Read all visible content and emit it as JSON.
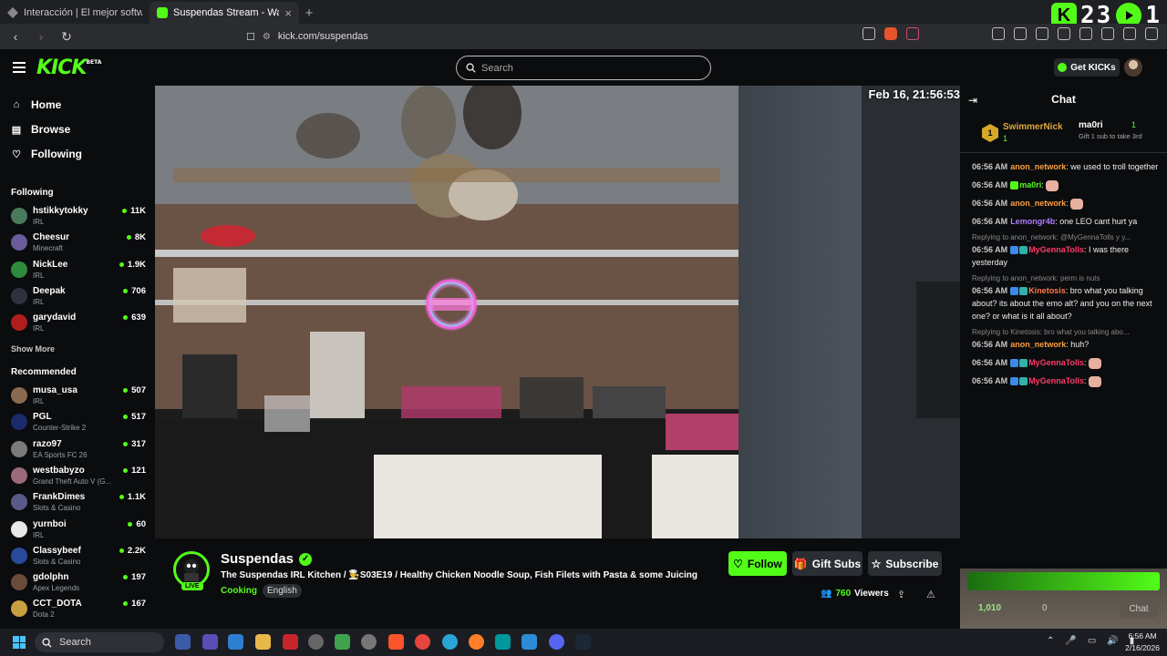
{
  "browser": {
    "tabs": [
      {
        "title": "Interacción | El mejor software para p",
        "active": false
      },
      {
        "title": "Suspendas Stream - Watch Li",
        "active": true
      }
    ],
    "new_tab": "+",
    "url": "kick.com/suspendas"
  },
  "overlay_counter": {
    "value": "23",
    "suffix": "1"
  },
  "header": {
    "logo": "KICK",
    "logo_badge": "BETA",
    "search_placeholder": "Search",
    "get_kicks_label": "Get KICKs"
  },
  "sidebar": {
    "nav": [
      {
        "label": "Home",
        "icon": "home-icon"
      },
      {
        "label": "Browse",
        "icon": "browse-icon"
      },
      {
        "label": "Following",
        "icon": "heart-icon"
      }
    ],
    "following_heading": "Following",
    "following": [
      {
        "name": "hstikkytokky",
        "category": "IRL",
        "viewers": "11K",
        "color": "#4a7a5c"
      },
      {
        "name": "Cheesur",
        "category": "Minecraft",
        "viewers": "8K",
        "color": "#6a5b9a"
      },
      {
        "name": "NickLee",
        "category": "IRL",
        "viewers": "1.9K",
        "color": "#2e8b3e"
      },
      {
        "name": "Deepak",
        "category": "IRL",
        "viewers": "706",
        "color": "#2d3140"
      },
      {
        "name": "garydavid",
        "category": "IRL",
        "viewers": "639",
        "color": "#b01d1d"
      }
    ],
    "show_more": "Show More",
    "recommended_heading": "Recommended",
    "recommended": [
      {
        "name": "musa_usa",
        "category": "IRL",
        "viewers": "507",
        "color": "#8a6a50"
      },
      {
        "name": "PGL",
        "category": "Counter-Strike 2",
        "viewers": "517",
        "color": "#1a2a6a"
      },
      {
        "name": "razo97",
        "category": "EA Sports FC 26",
        "viewers": "317",
        "color": "#7a7a7a"
      },
      {
        "name": "westbabyzo",
        "category": "Grand Theft Auto V (G...",
        "viewers": "121",
        "color": "#9a6a7a"
      },
      {
        "name": "FrankDimes",
        "category": "Slots & Casino",
        "viewers": "1.1K",
        "color": "#5a5a8a"
      },
      {
        "name": "yurnboi",
        "category": "IRL",
        "viewers": "60",
        "color": "#e8e8e8"
      },
      {
        "name": "Classybeef",
        "category": "Slots & Casino",
        "viewers": "2.2K",
        "color": "#2a4a9a"
      },
      {
        "name": "gdolphn",
        "category": "Apex Legends",
        "viewers": "197",
        "color": "#6a4a3a"
      },
      {
        "name": "CCT_DOTA",
        "category": "Dota 2",
        "viewers": "167",
        "color": "#c8a040"
      }
    ]
  },
  "video": {
    "timestamp": "Feb 16, 21:56:53"
  },
  "stream": {
    "streamer": "Suspendas",
    "live_label": "LIVE",
    "title": "The Suspendas IRL Kitchen / 👨‍🍳S03E19 / Healthy Chicken Noodle Soup, Fish Filets with Pasta & some Juicing",
    "category": "Cooking",
    "language": "English",
    "follow_label": "Follow",
    "gift_label": "Gift Subs",
    "subscribe_label": "Subscribe",
    "viewers": "760",
    "viewers_label": "Viewers"
  },
  "chat": {
    "heading": "Chat",
    "pinned_user": "SwimmerNick",
    "pinned_rank": "1",
    "pinned_count": "1",
    "gifter": "ma0ri",
    "gifter_count": "1",
    "gift_text": "Gift 1 sub to take 3rd",
    "messages": [
      {
        "time": "06:56 AM",
        "user": "anon_network",
        "color": "#ff9f40",
        "text": "we used to troll together",
        "reply": ""
      },
      {
        "time": "06:56 AM",
        "user": "ma0ri",
        "color": "#53fc18",
        "text": "",
        "reply": ""
      },
      {
        "time": "06:56 AM",
        "user": "anon_network",
        "color": "#ff9f40",
        "text": "",
        "reply": ""
      },
      {
        "time": "06:56 AM",
        "user": "Lemongr4b",
        "color": "#b07cff",
        "text": "one LEO cant hurt ya",
        "reply": ""
      },
      {
        "time": "06:56 AM",
        "user": "MyGennaTolls",
        "color": "#ff3b6b",
        "text": "I was there yesterday",
        "reply": "Replying to anon_network: @MyGennaTolls y y..."
      },
      {
        "time": "06:56 AM",
        "user": "Kinetosis",
        "color": "#ff7b4a",
        "text": "bro what you talking about? its about the emo alt? and you on the next one? or what is it all about?",
        "reply": "Replying to anon_network: perm is nuts"
      },
      {
        "time": "06:56 AM",
        "user": "anon_network",
        "color": "#ff9f40",
        "text": "huh?",
        "reply": "Replying to Kinetosis: bro what you talking abo..."
      },
      {
        "time": "06:56 AM",
        "user": "MyGennaTolls",
        "color": "#ff3b6b",
        "text": "",
        "reply": ""
      },
      {
        "time": "06:56 AM",
        "user": "MyGennaTolls",
        "color": "#ff3b6b",
        "text": "",
        "reply": ""
      }
    ],
    "points": "1,010",
    "points2": "0",
    "chat_button": "Chat"
  },
  "taskbar": {
    "search_placeholder": "Search",
    "time": "6:56 AM",
    "date": "2/16/2026"
  }
}
